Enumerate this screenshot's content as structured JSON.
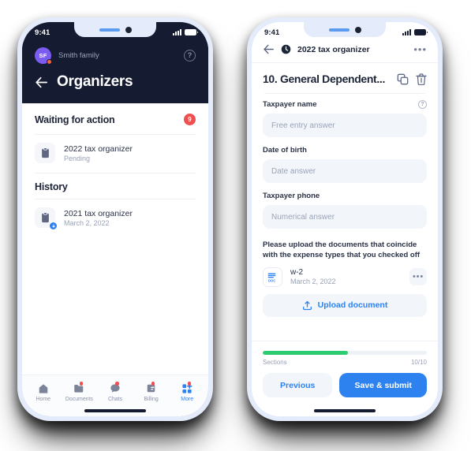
{
  "theme": {
    "dark_header": "#151c32",
    "accent_blue": "#2d82f0",
    "badge_red": "#ef4f4f",
    "progress_green": "#2ecc71",
    "avatar_purple": "#7c5cf0",
    "field_bg": "#f2f5fa"
  },
  "left_phone": {
    "status_bar": {
      "time": "9:41"
    },
    "account": {
      "avatar_initials": "SF",
      "name": "Smith family",
      "help_label": "?"
    },
    "header": {
      "title": "Organizers",
      "back_icon": "back-arrow-icon"
    },
    "waiting_section": {
      "title": "Waiting for action",
      "count": "9",
      "items": [
        {
          "title": "2022 tax organizer",
          "subtitle": "Pending",
          "icon": "clipboard-icon"
        }
      ]
    },
    "history_section": {
      "title": "History",
      "items": [
        {
          "title": "2021 tax organizer",
          "subtitle": "March 2, 2022",
          "icon": "clipboard-download-icon"
        }
      ]
    },
    "tabbar": {
      "tabs": [
        {
          "label": "Home",
          "icon": "home-icon",
          "active": false,
          "badge": false
        },
        {
          "label": "Documents",
          "icon": "folder-icon",
          "active": false,
          "badge": true
        },
        {
          "label": "Chats",
          "icon": "chat-bubble-icon",
          "active": false,
          "badge": true
        },
        {
          "label": "Billing",
          "icon": "billing-card-icon",
          "active": false,
          "badge": true
        },
        {
          "label": "More",
          "icon": "grid-plus-icon",
          "active": true,
          "badge": true
        }
      ]
    }
  },
  "right_phone": {
    "status_bar": {
      "time": "9:41"
    },
    "header": {
      "back_icon": "back-arrow-icon",
      "clock_icon": "clock-icon",
      "title": "2022 tax organizer",
      "menu_label": "•••"
    },
    "question": {
      "title": "10. General Dependent...",
      "copy_icon": "copy-icon",
      "delete_icon": "trash-icon"
    },
    "fields": [
      {
        "label": "Taxpayer name",
        "placeholder": "Free entry answer",
        "has_help": true
      },
      {
        "label": "Date of birth",
        "placeholder": "Date answer",
        "has_help": false
      },
      {
        "label": "Taxpayer phone",
        "placeholder": "Numerical answer",
        "has_help": false
      }
    ],
    "upload": {
      "prompt": "Please upload the documents that coincide with the expense types that you checked off",
      "documents": [
        {
          "name": "w-2",
          "date": "March 2, 2022",
          "icon": "doc-icon",
          "menu_label": "•••"
        }
      ],
      "button_label": "Upload document",
      "button_icon": "upload-icon"
    },
    "progress": {
      "label": "Sections",
      "value": "10/10",
      "percent": 52
    },
    "actions": {
      "previous_label": "Previous",
      "submit_label": "Save & submit"
    }
  }
}
